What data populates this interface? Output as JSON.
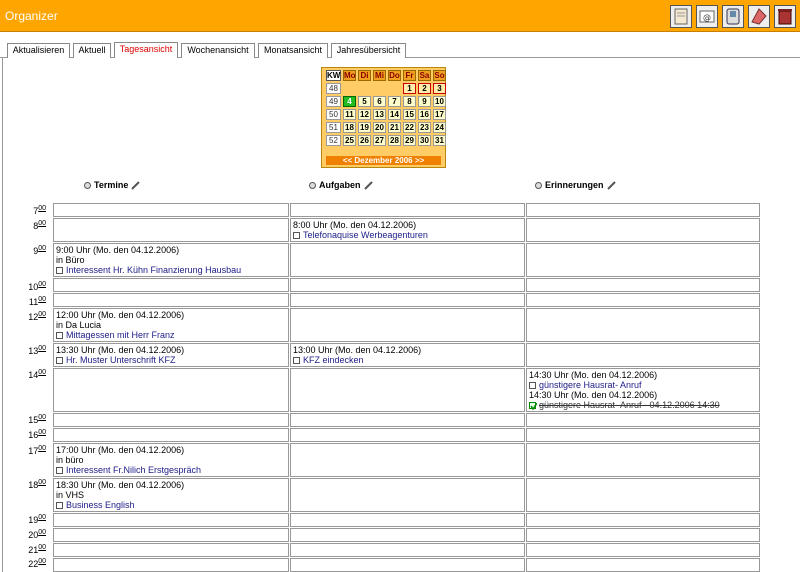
{
  "app_title": "Organizer",
  "tabs": [
    "Aktualisieren",
    "Aktuell",
    "Tagesansicht",
    "Wochenansicht",
    "Monatsansicht",
    "Jahresübersicht"
  ],
  "toolbar": [
    "notes-icon",
    "email-icon",
    "phone-icon",
    "memo-icon",
    "trash-icon"
  ],
  "calendar": {
    "kw_label": "KW",
    "weekdays": [
      "Mo",
      "Di",
      "Mi",
      "Do",
      "Fr",
      "Sa",
      "So"
    ],
    "weeks": [
      "48",
      "49",
      "50",
      "51",
      "52"
    ],
    "days": [
      [
        "",
        "",
        "",
        "",
        "1",
        "2",
        "3"
      ],
      [
        "4",
        "5",
        "6",
        "7",
        "8",
        "9",
        "10"
      ],
      [
        "11",
        "12",
        "13",
        "14",
        "15",
        "16",
        "17"
      ],
      [
        "18",
        "19",
        "20",
        "21",
        "22",
        "23",
        "24"
      ],
      [
        "25",
        "26",
        "27",
        "28",
        "29",
        "30",
        "31"
      ]
    ],
    "nav": "<< Dezember 2006 >>",
    "today_color": "#22BB22"
  },
  "columns": {
    "termine": "Termine",
    "aufgaben": "Aufgaben",
    "erinnerungen": "Erinnerungen"
  },
  "hours": [
    "7",
    "8",
    "9",
    "10",
    "11",
    "12",
    "13",
    "14",
    "15",
    "16",
    "17",
    "18",
    "19",
    "20",
    "21",
    "22"
  ],
  "hour_sup": "00",
  "entries": {
    "t9": {
      "l1": "9:00 Uhr (Mo. den 04.12.2006)",
      "l2": "in Büro",
      "link": "Interessent Hr. Kühn Finanzierung Hausbau"
    },
    "t12": {
      "l1": "12:00 Uhr (Mo. den 04.12.2006)",
      "l2": "in Da Lucia",
      "link": "Mittagessen mit Herr Franz"
    },
    "t13": {
      "l1": "13:30 Uhr (Mo. den 04.12.2006)",
      "link": "Hr. Muster Unterschrift KFZ"
    },
    "t17": {
      "l1": "17:00 Uhr (Mo. den 04.12.2006)",
      "l2": "in büro",
      "link": "Interessent Fr.Nilich Erstgespräch"
    },
    "t18": {
      "l1": "18:30 Uhr (Mo. den 04.12.2006)",
      "l2": "in VHS",
      "link": "Business English"
    },
    "a8": {
      "l1": "8:00 Uhr (Mo. den 04.12.2006)",
      "link": "Telefonaquise Werbeagenturen"
    },
    "a13": {
      "l1": "13:00 Uhr (Mo. den 04.12.2006)",
      "link": "KFZ eindecken"
    },
    "e14": {
      "l1": "14:30 Uhr (Mo. den 04.12.2006)",
      "link": "günstigere Hausrat- Anruf",
      "l3": "14:30 Uhr (Mo. den 04.12.2006)",
      "done": "günstigere Hausrat- Anruf - 04.12.2006 14:30"
    }
  }
}
